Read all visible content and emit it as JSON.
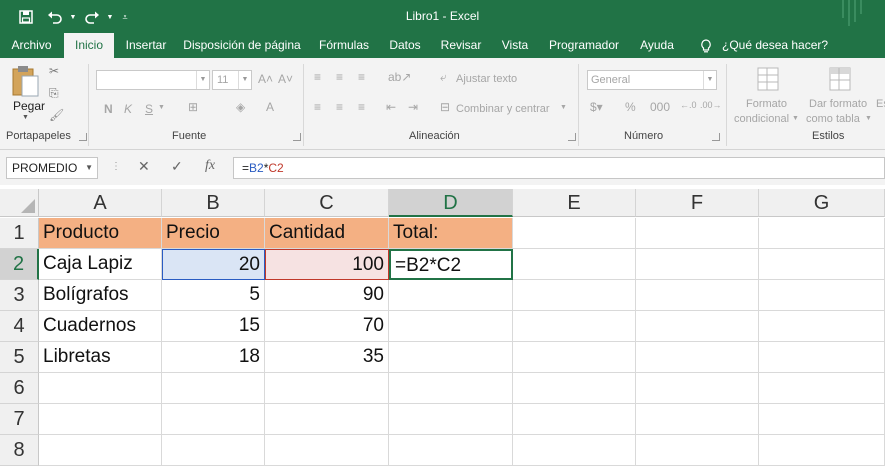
{
  "window": {
    "title": "Libro1  -  Excel"
  },
  "qat": {
    "icons": [
      "save-icon",
      "undo-icon",
      "redo-icon",
      "customize-icon"
    ]
  },
  "tabs": [
    {
      "label": "Archivo"
    },
    {
      "label": "Inicio",
      "active": true
    },
    {
      "label": "Insertar"
    },
    {
      "label": "Disposición de página"
    },
    {
      "label": "Fórmulas"
    },
    {
      "label": "Datos"
    },
    {
      "label": "Revisar"
    },
    {
      "label": "Vista"
    },
    {
      "label": "Programador"
    },
    {
      "label": "Ayuda"
    },
    {
      "label": "¿Qué desea hacer?"
    }
  ],
  "ribbon": {
    "clipboard": {
      "paste_label": "Pegar",
      "group_label": "Portapapeles"
    },
    "font": {
      "size": "11",
      "bold": "N",
      "italic": "K",
      "underline": "S",
      "group_label": "Fuente"
    },
    "alignment": {
      "wrap_label": "Ajustar texto",
      "merge_label": "Combinar y centrar",
      "group_label": "Alineación"
    },
    "number": {
      "format": "General",
      "group_label": "Número"
    },
    "styles": {
      "conditional_line1": "Formato",
      "conditional_line2": "condicional",
      "table_line1": "Dar formato",
      "table_line2": "como tabla",
      "cut_label": "Es",
      "group_label": "Estilos"
    }
  },
  "formula_bar": {
    "name_box": "PROMEDIO",
    "cancel": "✕",
    "enter": "✓",
    "fx": "fx",
    "formula_prefix": "=",
    "ref1": "B2",
    "op": "*",
    "ref2": "C2"
  },
  "sheet": {
    "columns": [
      "A",
      "B",
      "C",
      "D",
      "E",
      "F",
      "G"
    ],
    "rows": [
      "1",
      "2",
      "3",
      "4",
      "5",
      "6",
      "7",
      "8"
    ],
    "selected_column": "D",
    "selected_row": "2",
    "header": [
      "Producto",
      "Precio",
      "Cantidad",
      "Total:"
    ],
    "data": [
      [
        "Caja Lapiz",
        "20",
        "100",
        "=B2*C2"
      ],
      [
        "Bolígrafos",
        "5",
        "90",
        ""
      ],
      [
        "Cuadernos",
        "15",
        "70",
        ""
      ],
      [
        "Libretas",
        "18",
        "35",
        ""
      ]
    ],
    "colors": {
      "header_fill": "#F4B083",
      "ref1": "#2A5CC2",
      "ref2": "#C0392B",
      "accent": "#217346"
    }
  }
}
